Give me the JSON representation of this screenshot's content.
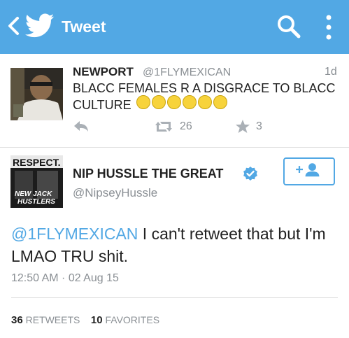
{
  "header": {
    "title": "Tweet",
    "back_icon": "chevron-left-icon",
    "logo_icon": "twitter-bird-icon",
    "search_icon": "search-icon",
    "menu_icon": "overflow-menu-icon",
    "bg_color": "#52a8e4"
  },
  "tweet1": {
    "name": "NEWPORT",
    "handle": "@1FLYMEXICAN",
    "time": "1d",
    "text": "BLACC FEMALES R A DISGRACE TO BLACC CULTURE",
    "emoji_count": 6,
    "retweets": "26",
    "favorites": "3"
  },
  "tweet2": {
    "avatar_text_top": "RESPECT.",
    "avatar_text_bottom": "NEW JACK HUSTLERS",
    "name": "NIP HUSSLE THE GREAT",
    "handle": "@NipseyHussle",
    "mention": "@1FLYMEXICAN",
    "text": " I can't retweet that but I'm LMAO TRU shit.",
    "timestamp": "12:50 AM · 02 Aug 15",
    "retweet_count": "36",
    "retweet_label": "RETWEETS",
    "favorite_count": "10",
    "favorite_label": "FAVORITES"
  },
  "colors": {
    "accent": "#52a8e4",
    "muted": "#8a8f94",
    "text": "#222222",
    "emoji": "#f7d33b"
  }
}
